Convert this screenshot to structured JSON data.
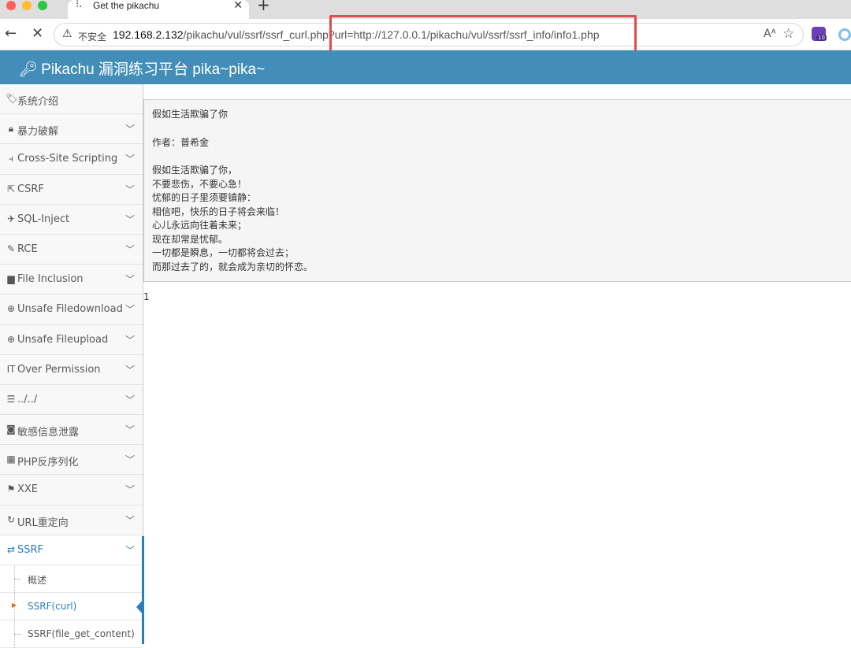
{
  "browser": {
    "tab": {
      "title": "Get the pikachu",
      "icon": "loading-icon"
    },
    "address": {
      "security_label": "不安全",
      "host": "192.168.2.132",
      "path": "/pikachu/vul/ssrf/ssrf_curl.php",
      "query": "?url=http://127.0.0.1/pikachu/vul/ssrf/ssrf_info/info1.php"
    },
    "extension_badge": "10"
  },
  "header": {
    "title": "Pikachu 漏洞练习平台 pika~pika~"
  },
  "sidebar": {
    "items": [
      {
        "label": "系统介绍",
        "icon": "tag-icon",
        "expandable": false
      },
      {
        "label": "暴力破解",
        "icon": "lock-icon",
        "expandable": true
      },
      {
        "label": "Cross-Site Scripting",
        "icon": "code-fork-icon",
        "expandable": true
      },
      {
        "label": "CSRF",
        "icon": "share-icon",
        "expandable": true
      },
      {
        "label": "SQL-Inject",
        "icon": "plane-icon",
        "expandable": true
      },
      {
        "label": "RCE",
        "icon": "pencil-icon",
        "expandable": true
      },
      {
        "label": "File Inclusion",
        "icon": "file-icon",
        "expandable": true
      },
      {
        "label": "Unsafe Filedownload",
        "icon": "download-icon",
        "expandable": true
      },
      {
        "label": "Unsafe Fileupload",
        "icon": "upload-icon",
        "expandable": true
      },
      {
        "label": "Over Permission",
        "icon": "text-cursor-icon",
        "expandable": true
      },
      {
        "label": "../../",
        "icon": "list-icon",
        "expandable": true
      },
      {
        "label": "敏感信息泄露",
        "icon": "camera-icon",
        "expandable": true
      },
      {
        "label": "PHP反序列化",
        "icon": "grid-icon",
        "expandable": true
      },
      {
        "label": "XXE",
        "icon": "flag-icon",
        "expandable": true
      },
      {
        "label": "URL重定向",
        "icon": "refresh-icon",
        "expandable": true
      },
      {
        "label": "SSRF",
        "icon": "exchange-icon",
        "expandable": true,
        "active": true
      }
    ],
    "sub_items": [
      {
        "label": "概述"
      },
      {
        "label": "SSRF(curl)",
        "current": true
      },
      {
        "label": "SSRF(file_get_content)"
      }
    ]
  },
  "content": {
    "title": "假如生活欺骗了你",
    "author": "作者：普希金",
    "lines": [
      "假如生活欺骗了你，",
      "不要悲伤，不要心急！",
      "忧郁的日子里须要镇静：",
      "相信吧，快乐的日子将会来临！",
      "心儿永远向往着未来；",
      "现在却常是忧郁。",
      "一切都是瞬息，一切都将会过去；",
      "而那过去了的，就会成为亲切的怀恋。"
    ],
    "result_text": "1"
  },
  "colors": {
    "header_bg": "#438eb9",
    "active_link": "#2b7dbc",
    "highlight_box": "#e24a4f"
  }
}
